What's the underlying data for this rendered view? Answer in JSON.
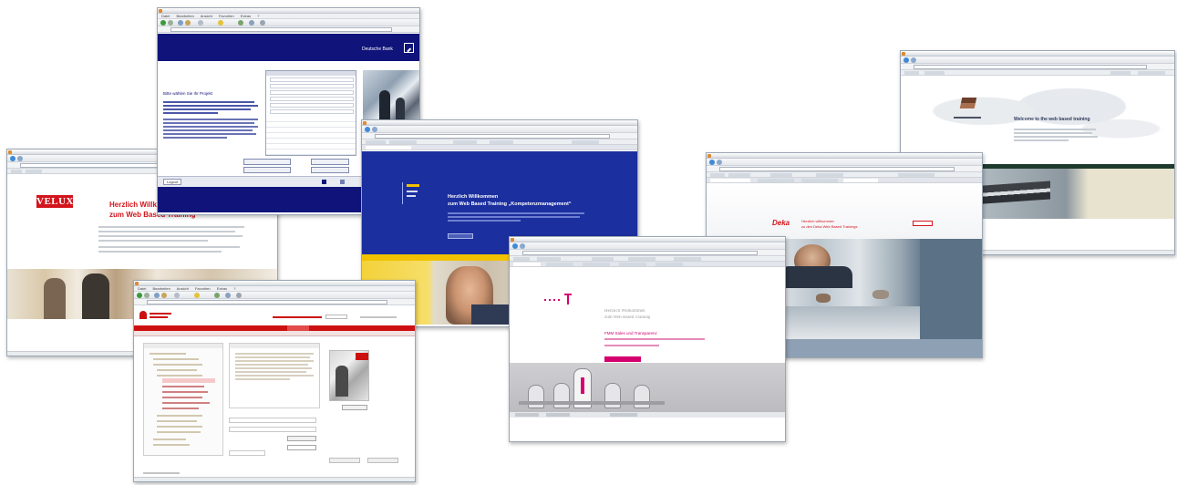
{
  "collage": {
    "window_deutsche_bank": {
      "brand": "Deutsche Bank",
      "menu": [
        "Datei",
        "Bearbeiten",
        "Ansicht",
        "Favoriten",
        "Extras",
        "?"
      ],
      "intro_heading": "Bitte wählen Sie Ihr Projekt",
      "footer_button": "Logout",
      "accent_color": "#10147a"
    },
    "window_velux": {
      "logo": "VELUX",
      "heading_line1": "Herzlich Willkommen",
      "heading_line2": "zum Web Based Training",
      "accent_color": "#d4141c"
    },
    "window_kompetenz": {
      "heading_line1": "Herzlich Willkommen",
      "heading_line2": "zum Web Based Training „Kompetenzmanagement“",
      "accent_color": "#1b2f9e",
      "secondary_color": "#f2c200"
    },
    "window_sparkasse": {
      "menu": [
        "Datei",
        "Bearbeiten",
        "Ansicht",
        "Favoriten",
        "Extras",
        "?"
      ],
      "accent_color": "#cc1010"
    },
    "window_telekom": {
      "heading_line1": "Herzlich Willkommen",
      "heading_line2": "zum Web Based Training",
      "subheading": "FMM Sales und Transparenz",
      "accent_color": "#d4006e"
    },
    "window_deka": {
      "logo": "Deka",
      "heading_line1": "Herzlich willkommen",
      "heading_line2": "zu den Deka Web Based Trainings",
      "accent_color": "#d4141c"
    },
    "window_shipping": {
      "heading": "Welcome to the web based training",
      "accent_color": "#1e3a2c"
    }
  }
}
